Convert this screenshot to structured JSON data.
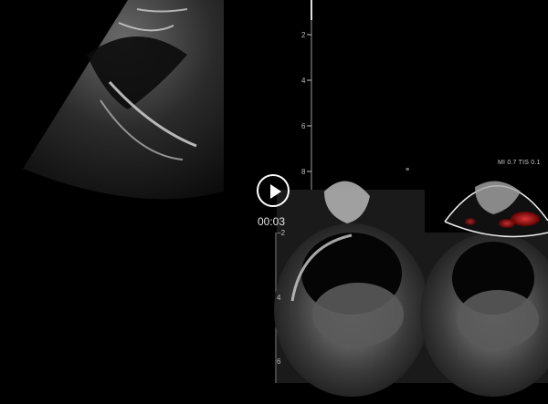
{
  "player": {
    "play_label": "▶",
    "time": "00:03"
  },
  "scale": {
    "top_depths": [
      "2",
      "4",
      "6",
      "8"
    ],
    "bottom_depths": [
      "−2",
      "4",
      "6"
    ]
  },
  "pane_marker": "≡",
  "readout": "MI 0.7  TIS 0.1",
  "colors": {
    "background": "#000000",
    "doppler": "#c81414"
  }
}
